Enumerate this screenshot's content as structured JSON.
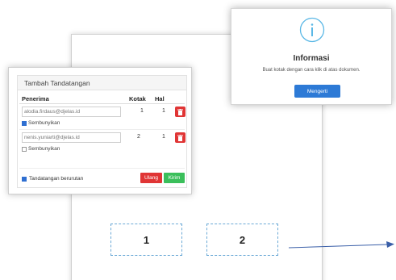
{
  "panel": {
    "title": "Tambah Tandatangan",
    "columns": {
      "recipient": "Penerima",
      "box": "Kotak",
      "page": "Hal"
    },
    "rows": [
      {
        "email": "alodia.firdaus@djelas.id",
        "box": "1",
        "page": "1",
        "hide_label": "Sembunyikan",
        "hide_checked": true
      },
      {
        "email": "nenis.yuniarti@djelas.id",
        "box": "2",
        "page": "1",
        "hide_label": "Sembunyikan",
        "hide_checked": false
      }
    ],
    "sequential_label": "Tandatangan berurutan",
    "sequential_checked": true,
    "reset_label": "Ulang",
    "send_label": "Kirim"
  },
  "dialog": {
    "icon": "info-icon",
    "title": "Informasi",
    "message": "Buat kotak dengan cara klik di atas dokumen.",
    "button_label": "Mengerti"
  },
  "document": {
    "boxes": [
      "1",
      "2"
    ]
  },
  "colors": {
    "danger": "#e03535",
    "success": "#3bbf5b",
    "primary": "#2d7ad6",
    "box_border": "#6ba9d6",
    "info_icon": "#5bb8e6"
  }
}
